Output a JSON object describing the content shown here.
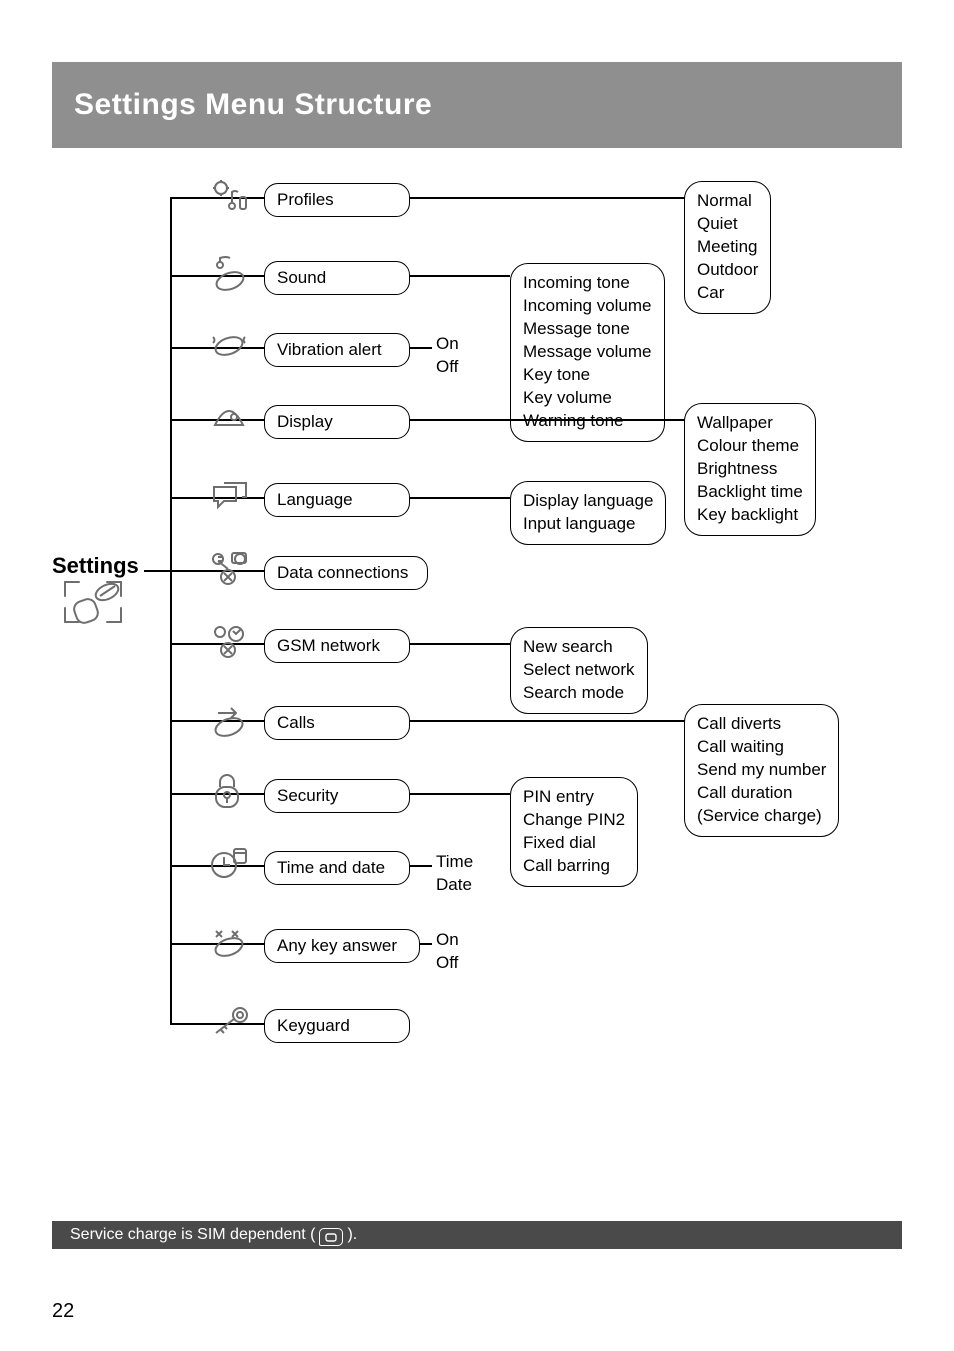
{
  "header": {
    "title": "Settings Menu Structure"
  },
  "root": {
    "label": "Settings"
  },
  "menu": {
    "profiles": "Profiles",
    "sound": "Sound",
    "vibration": "Vibration alert",
    "display": "Display",
    "language": "Language",
    "dataconn": "Data connections",
    "gsm": "GSM network",
    "calls": "Calls",
    "security": "Security",
    "timedate": "Time and date",
    "anykey": "Any key answer",
    "keyguard": "Keyguard"
  },
  "opts": {
    "profiles": "Normal\nQuiet\nMeeting\nOutdoor\nCar",
    "sound": "Incoming tone\nIncoming volume\nMessage tone\nMessage volume\nKey tone\nKey volume\nWarning tone",
    "vibration": "On\nOff",
    "display": "Wallpaper\nColour theme\nBrightness\nBacklight time\nKey backlight",
    "language": "Display language\nInput language",
    "gsm": "New search\nSelect network\nSearch mode",
    "calls": "Call diverts\nCall waiting\nSend my number\nCall duration\n(Service charge)",
    "security": "PIN entry\nChange PIN2\nFixed dial\nCall barring",
    "timedate": "Time\nDate",
    "anykey": "On\nOff"
  },
  "footer": {
    "before": "Service charge is SIM dependent (",
    "after": ")."
  },
  "page": "22"
}
